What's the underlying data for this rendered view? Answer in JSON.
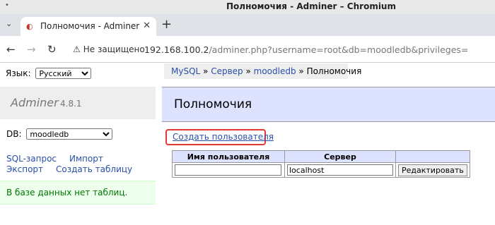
{
  "window": {
    "title": "Полномочия - Adminer – Chromium"
  },
  "tab": {
    "label": "Полномочия - Adminer"
  },
  "addressbar": {
    "security_text": "Не защищено",
    "url_host": "192.168.100.2",
    "url_path": "/adminer.php?username=root&db=moodledb&privileges="
  },
  "lang": {
    "label": "Язык:",
    "selected": "Русский"
  },
  "breadcrumb": {
    "mysql": "MySQL",
    "sep1": " » ",
    "server": "Сервер",
    "sep2": " » ",
    "db": "moodledb",
    "sep3": " » ",
    "current": "Полномочия"
  },
  "logo": {
    "name": "Adminer",
    "version": "4.8.1"
  },
  "header": {
    "title": "Полномочия"
  },
  "db": {
    "label": "DB:",
    "selected": "moodledb"
  },
  "links": {
    "sql": "SQL-запрос",
    "import": "Импорт",
    "export": "Экспорт",
    "create_table": "Создать таблицу"
  },
  "notice": "В базе данных нет таблиц.",
  "create_user": "Создать пользователя",
  "table": {
    "headers": [
      "Имя пользователя",
      "Сервер",
      ""
    ],
    "row": {
      "username": "",
      "server": "localhost",
      "edit_button": "Редактировать"
    }
  },
  "colors": {
    "accent_blue": "#2a4fa8",
    "header_bg": "#dde2ff",
    "notice_bg": "#eeffee",
    "highlight_border": "#e53935"
  }
}
